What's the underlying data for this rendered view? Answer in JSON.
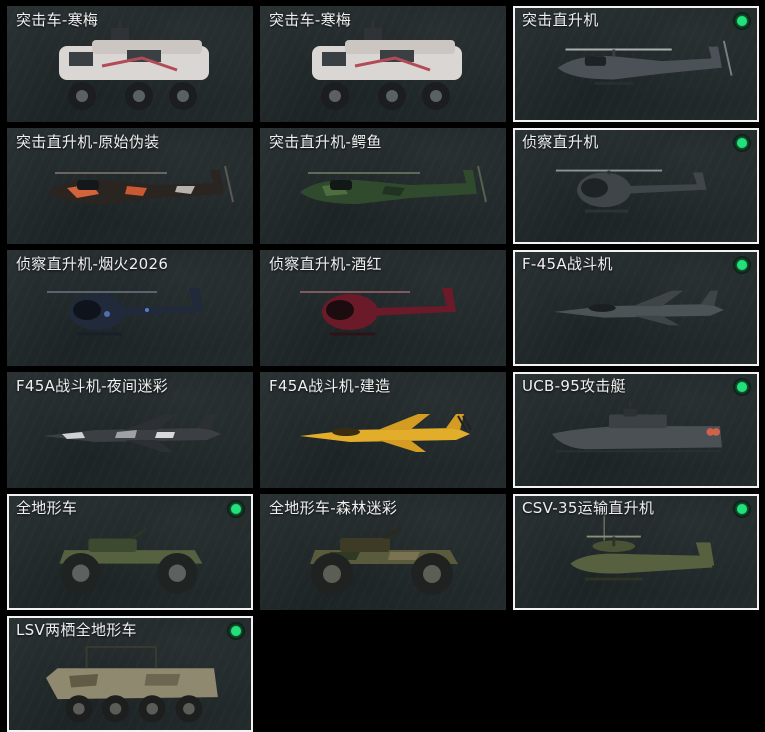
{
  "vehicles": [
    {
      "name": "突击车-寒梅",
      "selected": false,
      "icon": "armored-car-icon"
    },
    {
      "name": "突击车-寒梅",
      "selected": false,
      "icon": "armored-car-icon"
    },
    {
      "name": "突击直升机",
      "selected": true,
      "icon": "attack-helicopter-icon"
    },
    {
      "name": "突击直升机-原始伪装",
      "selected": false,
      "icon": "attack-helicopter-icon"
    },
    {
      "name": "突击直升机-鳄鱼",
      "selected": false,
      "icon": "attack-helicopter-icon"
    },
    {
      "name": "侦察直升机",
      "selected": true,
      "icon": "scout-helicopter-icon"
    },
    {
      "name": "侦察直升机-烟火2026",
      "selected": false,
      "icon": "scout-helicopter-icon"
    },
    {
      "name": "侦察直升机-酒红",
      "selected": false,
      "icon": "scout-helicopter-icon"
    },
    {
      "name": "F-45A战斗机",
      "selected": true,
      "icon": "fighter-jet-icon"
    },
    {
      "name": "F45A战斗机-夜间迷彩",
      "selected": false,
      "icon": "fighter-jet-icon"
    },
    {
      "name": "F45A战斗机-建造",
      "selected": false,
      "icon": "fighter-jet-icon"
    },
    {
      "name": "UCB-95攻击艇",
      "selected": true,
      "icon": "attack-boat-icon"
    },
    {
      "name": "全地形车",
      "selected": true,
      "icon": "atv-icon"
    },
    {
      "name": "全地形车-森林迷彩",
      "selected": false,
      "icon": "atv-icon"
    },
    {
      "name": "CSV-35运输直升机",
      "selected": true,
      "icon": "transport-tiltrotor-icon"
    },
    {
      "name": "LSV两栖全地形车",
      "selected": true,
      "icon": "amphibious-vehicle-icon"
    }
  ],
  "colors": {
    "selected_border": "#f2f2f2",
    "owned_indicator": "#22e07a",
    "card_background": "#1d2426"
  }
}
